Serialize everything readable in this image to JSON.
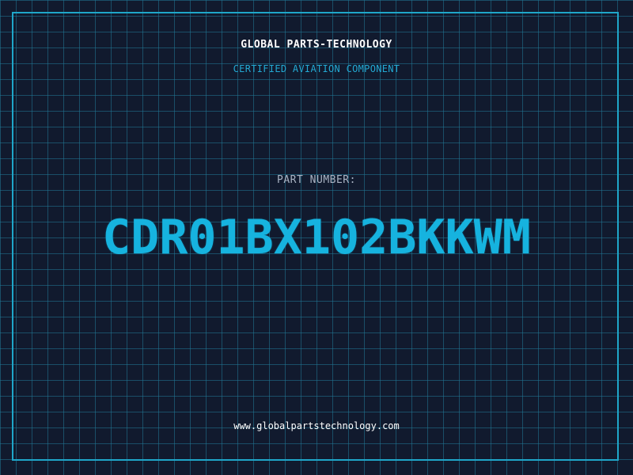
{
  "header": {
    "company": "GLOBAL PARTS-TECHNOLOGY",
    "subtitle": "CERTIFIED AVIATION COMPONENT"
  },
  "part": {
    "label": "PART NUMBER:",
    "number": "CDR01BX102BKKWM"
  },
  "footer": {
    "website": "www.globalpartstechnology.com"
  },
  "colors": {
    "background": "#111a2e",
    "grid": "#1f6e8a",
    "frame": "#1fa6c9",
    "accent": "#16b3df",
    "label": "#aab4c4",
    "text": "#ffffff"
  }
}
